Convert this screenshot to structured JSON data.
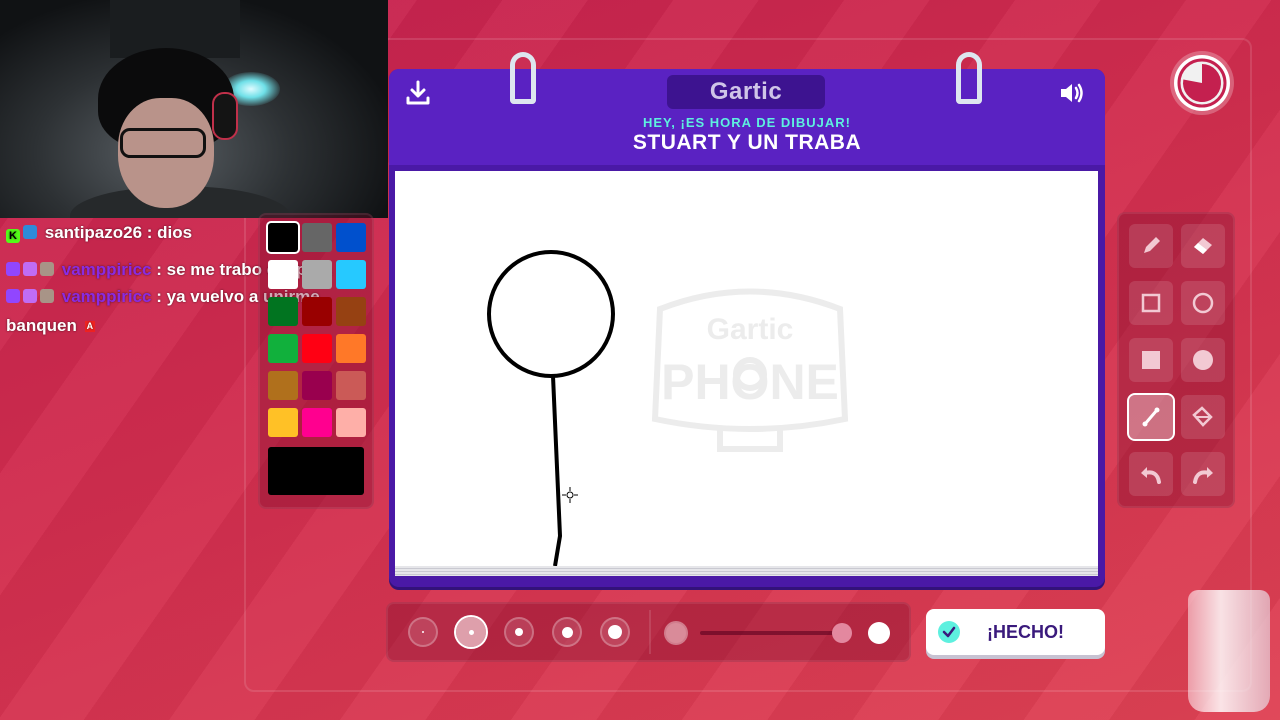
{
  "webcam": {
    "label": "webcam-feed"
  },
  "chat": {
    "messages": [
      {
        "user": "santipazo26",
        "separator": " : ",
        "text": "dios",
        "badges": [
          "kick-icon",
          "moderator-icon"
        ]
      },
      {
        "user": "vamppiricc",
        "separator": " : ",
        "text": "se me trabo el opera bld",
        "badges": [
          "twitch-icon",
          "subscriber-icon",
          "avatar-icon"
        ]
      },
      {
        "user": "vamppiricc",
        "separator": " : ",
        "text": "ya vuelvo a unirme banquen",
        "badges": [
          "twitch-icon",
          "subscriber-icon",
          "avatar-icon"
        ],
        "trailing_badge": "A"
      }
    ]
  },
  "palette": {
    "colors": [
      "#000000",
      "#666666",
      "#0050cd",
      "#ffffff",
      "#aaaaaa",
      "#26c9ff",
      "#017420",
      "#990000",
      "#964112",
      "#11b03c",
      "#ff0013",
      "#ff7828",
      "#b0701c",
      "#99004e",
      "#cb5a57",
      "#ffc126",
      "#ff008f",
      "#feafa8"
    ],
    "selected": "#000000",
    "current_color": "#000000"
  },
  "game": {
    "brand": "Gartic",
    "prompt_small": "HEY, ¡ES HORA DE DIBUJAR!",
    "prompt_big": "STUART Y UN TRABA",
    "watermark": "Gartic PHONE",
    "accent": "#5a22c2",
    "prompt_accent": "#5ef0df"
  },
  "header_icons": {
    "download": "download-icon",
    "sound": "speaker-icon"
  },
  "tools": [
    {
      "name": "pencil",
      "icon": "pencil-icon",
      "active": false
    },
    {
      "name": "eraser",
      "icon": "eraser-icon",
      "active": false
    },
    {
      "name": "rectangle-outline",
      "icon": "square-outline-icon",
      "active": false
    },
    {
      "name": "ellipse-outline",
      "icon": "circle-outline-icon",
      "active": false
    },
    {
      "name": "rectangle-filled",
      "icon": "square-filled-icon",
      "active": false
    },
    {
      "name": "ellipse-filled",
      "icon": "circle-filled-icon",
      "active": false
    },
    {
      "name": "line",
      "icon": "line-icon",
      "active": true
    },
    {
      "name": "fill",
      "icon": "bucket-icon",
      "active": false
    },
    {
      "name": "undo",
      "icon": "undo-icon",
      "active": false
    },
    {
      "name": "redo",
      "icon": "redo-icon",
      "active": false
    }
  ],
  "brush_sizes": {
    "count": 5,
    "selected_index": 1
  },
  "opacity": {
    "value": 1.0
  },
  "done_button": {
    "label": "¡HECHO!"
  },
  "timer": {
    "icon": "timer-icon",
    "remaining_fraction": 0.78
  }
}
